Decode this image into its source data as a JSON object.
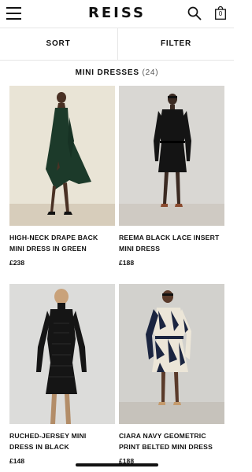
{
  "header": {
    "logo": "REISS",
    "bag_count": "0",
    "menu_icon": "hamburger-menu-icon",
    "search_icon": "search-icon",
    "bag_icon": "shopping-bag-icon"
  },
  "toolbar": {
    "sort_label": "SORT",
    "filter_label": "FILTER"
  },
  "category": {
    "name": "MINI DRESSES",
    "count": "(24)"
  },
  "products": [
    {
      "name_line1": "HIGH-NECK DRAPE BACK",
      "name_line2": "MINI DRESS IN GREEN",
      "price": "£238",
      "dress_color": "#1c3a2a",
      "bg_color": "#e8e2d4"
    },
    {
      "name_line1": "REEMA BLACK LACE INSERT",
      "name_line2": "MINI DRESS",
      "price": "£188",
      "dress_color": "#141414",
      "bg_color": "#d8d6d2"
    },
    {
      "name_line1": "RUCHED-JERSEY MINI",
      "name_line2": "DRESS IN BLACK",
      "price": "£148",
      "dress_color": "#151515",
      "bg_color": "#dcdcda"
    },
    {
      "name_line1": "CIARA NAVY GEOMETRIC",
      "name_line2": "PRINT BELTED MINI DRESS",
      "price": "£188",
      "dress_color": "#1b2540",
      "bg_color": "#cfcfcb"
    }
  ]
}
